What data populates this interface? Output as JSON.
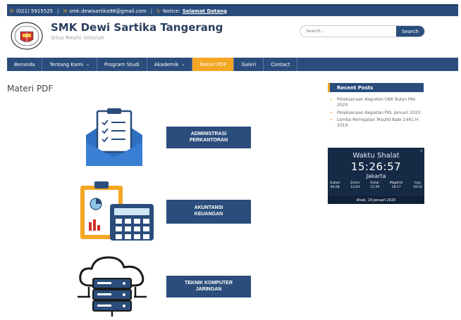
{
  "topbar": {
    "phone": "(021) 5915525",
    "email": "smk.dewisartika98@gmail.com",
    "notice_label": "Notice:",
    "notice_link": "Selamat Datang",
    "accent_color": "#f5a623"
  },
  "header": {
    "site_title": "SMK Dewi Sartika Tangerang",
    "site_subtitle": "Situs Resmi Sekolah",
    "search_placeholder": "Search...",
    "search_button": "Search"
  },
  "nav": {
    "items": [
      {
        "label": "Beranda",
        "dropdown": false,
        "active": false
      },
      {
        "label": "Tentang Kami",
        "dropdown": true,
        "active": false
      },
      {
        "label": "Program Studi",
        "dropdown": false,
        "active": false
      },
      {
        "label": "Akademik",
        "dropdown": true,
        "active": false
      },
      {
        "label": "Materi PDF",
        "dropdown": false,
        "active": true
      },
      {
        "label": "Galeri",
        "dropdown": false,
        "active": false
      },
      {
        "label": "Contact",
        "dropdown": false,
        "active": false
      }
    ]
  },
  "main": {
    "page_title": "Materi PDF",
    "categories": [
      {
        "line1": "ADMINISTRASI",
        "line2": "PERKANTORAN",
        "icon": "clipboard-envelope-icon"
      },
      {
        "line1": "AKUNTANSI",
        "line2": "KEUANGAN",
        "icon": "calculator-chart-icon"
      },
      {
        "line1": "TEKNIK KOMPUTER",
        "line2": "JARINGAN",
        "icon": "cloud-server-icon"
      }
    ]
  },
  "sidebar": {
    "recent_posts_title": "Recent Posts",
    "recent_posts": [
      "Pelaksanaan Kegiatan UKK Bulan Mei 2020",
      "Pelaksanaan Kegiatan PKL Januari 2020",
      "Lomba Peringatan Maulid Nabi 1441 H 2019"
    ],
    "prayer": {
      "title": "Waktu Shalat",
      "time": "15:26:57",
      "city": "Jakarta",
      "times": [
        {
          "name": "Subuh",
          "time": "04:28"
        },
        {
          "name": "Zuhur",
          "time": "12:04"
        },
        {
          "name": "Ashar",
          "time": "15:29"
        },
        {
          "name": "Maghrib",
          "time": "18:17"
        },
        {
          "name": "Isya",
          "time": "19:32"
        }
      ],
      "date": "Ahad, 19 Januari 2020"
    }
  },
  "colors": {
    "primary": "#2a4d7b",
    "accent": "#f5a623"
  }
}
